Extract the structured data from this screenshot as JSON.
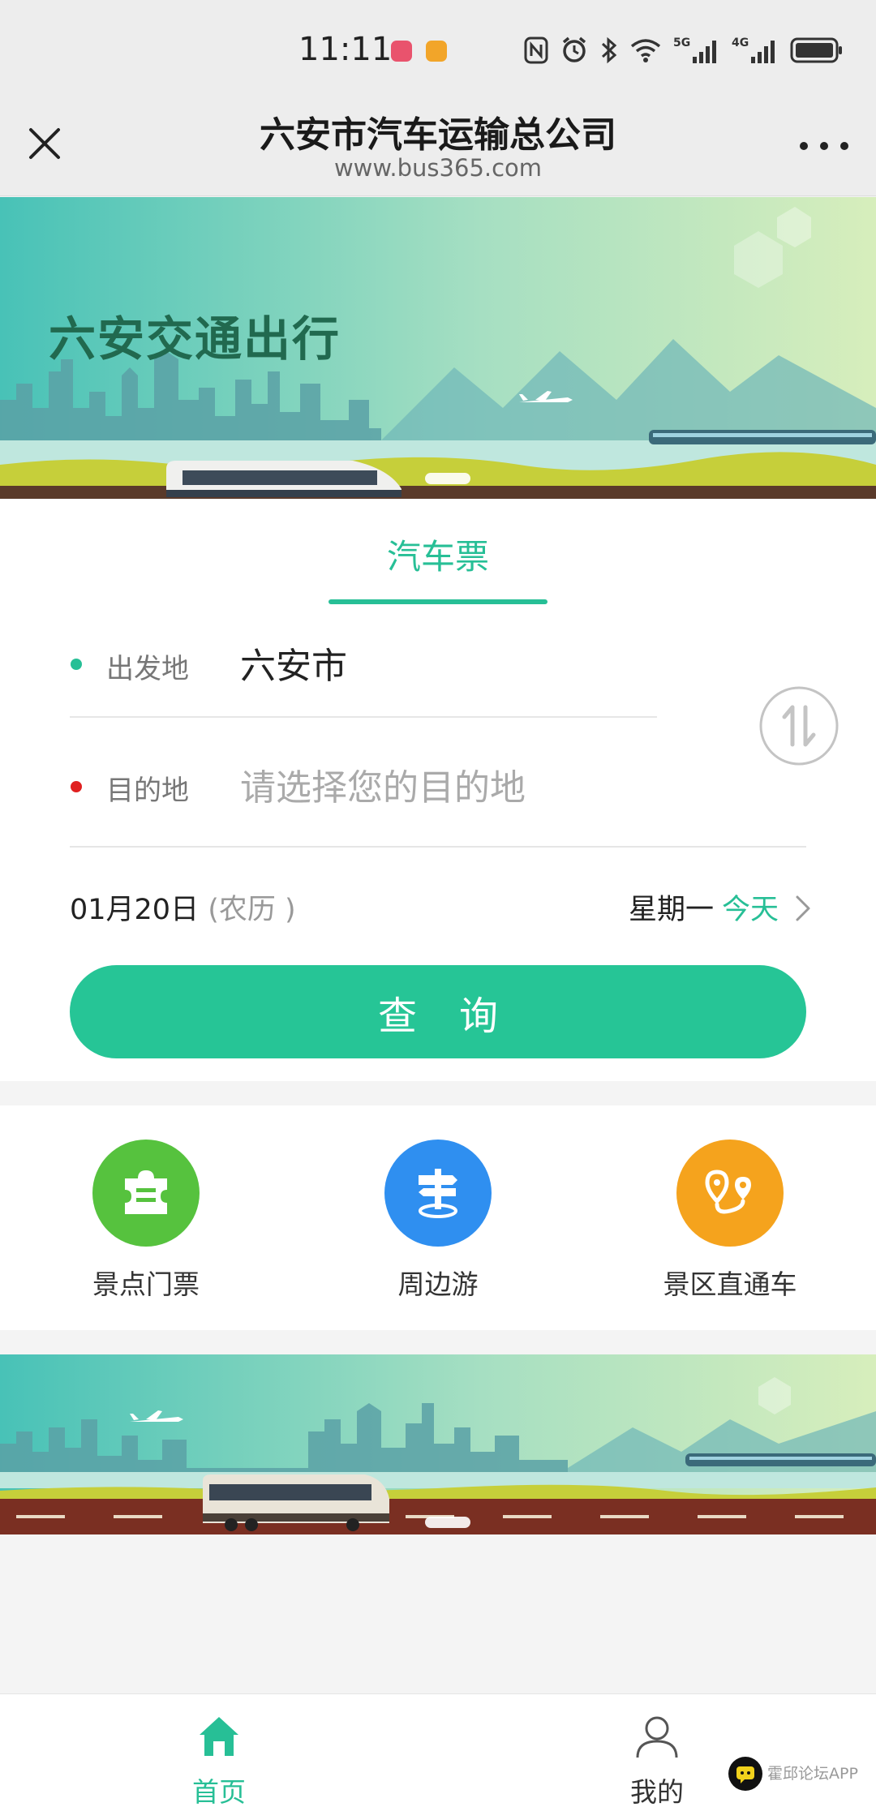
{
  "status_bar": {
    "time": "11:11",
    "icons": [
      "nfc-icon",
      "alarm-icon",
      "bluetooth-icon",
      "wifi-icon",
      "signal-5g-icon",
      "signal-4g-icon",
      "battery-icon"
    ],
    "network_5g": "5G",
    "network_4g": "4G"
  },
  "title_bar": {
    "title": "六安市汽车运输总公司",
    "url": "www.bus365.com"
  },
  "banner_top": {
    "title": "六安交通出行"
  },
  "ticket": {
    "tab_label": "汽车票",
    "departure_label": "出发地",
    "departure_value": "六安市",
    "destination_label": "目的地",
    "destination_placeholder": "请选择您的目的地",
    "date": "01月20日",
    "lunar": "(农历 )",
    "weekday": "星期一",
    "today": "今天",
    "query_button": "查询"
  },
  "services": [
    {
      "label": "景点门票",
      "icon": "ticket-icon",
      "color": "#56c23e"
    },
    {
      "label": "周边游",
      "icon": "signpost-icon",
      "color": "#2f8ff0"
    },
    {
      "label": "景区直通车",
      "icon": "route-pin-icon",
      "color": "#f5a31d"
    }
  ],
  "bottom_nav": {
    "home": "首页",
    "mine": "我的"
  },
  "watermark": {
    "text": "霍邱论坛APP"
  },
  "colors": {
    "accent": "#27bf96",
    "button": "#26c596",
    "destination_dot": "#e02020"
  }
}
